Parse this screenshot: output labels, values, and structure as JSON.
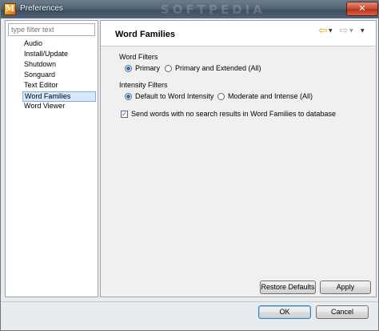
{
  "window": {
    "title": "Preferences",
    "watermark": "SOFTPEDIA",
    "app_icon": "app-logo-icon",
    "close_glyph": "✕"
  },
  "filter": {
    "placeholder": "type filter text",
    "value": "type filter text"
  },
  "tree": {
    "items": [
      "Audio",
      "Install/Update",
      "Shutdown",
      "Songuard",
      "Text Editor",
      "Word Families",
      "Word Viewer"
    ],
    "selected": "Word Families"
  },
  "page": {
    "title": "Word Families",
    "nav_back_icon": "⇦",
    "nav_forward_icon": "⇨",
    "dropdown_glyph": "▼"
  },
  "word_filters": {
    "label": "Word Filters",
    "options": [
      "Primary",
      "Primary and Extended (All)"
    ],
    "selected": "Primary"
  },
  "intensity_filters": {
    "label": "Intensity Filters",
    "options": [
      "Default to Word Intensity",
      "Moderate and Intense (All)"
    ],
    "selected": "Default to Word Intensity"
  },
  "send_words": {
    "label": "Send words with no search results in Word Families to database",
    "checked": true,
    "check_glyph": "✓"
  },
  "buttons": {
    "restore": "Restore Defaults",
    "apply": "Apply",
    "ok": "OK",
    "cancel": "Cancel"
  },
  "colors": {
    "selection": "#d6e8fb",
    "titlebar": "#4f6174",
    "close": "#c8492f"
  }
}
